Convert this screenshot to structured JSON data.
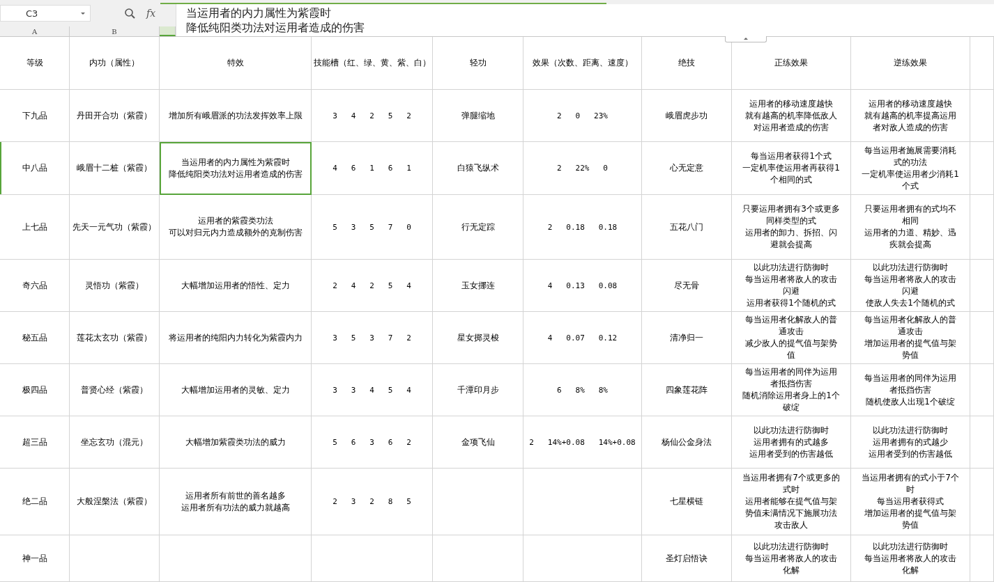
{
  "name_box": "C3",
  "fx_label": "fx",
  "formula": [
    "当运用者的内力属性为紫霞时",
    "降低纯阳类功法对运用者造成的伤害"
  ],
  "columns": [
    {
      "letter": "A",
      "selected": false
    },
    {
      "letter": "B",
      "selected": false
    },
    {
      "selected": true
    }
  ],
  "header": [
    "等级",
    "内功（属性）",
    "特效",
    "技能槽（红、绿、黄、紫、白）",
    "轻功",
    "效果（次数、距离、速度）",
    "绝技",
    "正练效果",
    "逆练效果"
  ],
  "rows": [
    {
      "selected": false,
      "cells": [
        "下九品",
        "丹田开合功（紫霞）",
        "增加所有峨眉派的功法发挥效率上限",
        "3   4   2   5   2",
        "弹腿缩地",
        "2   0   23%",
        "峨眉虎步功",
        [
          "运用者的移动速度越快",
          "就有越高的机率降低敌人对运用者造成的伤害"
        ],
        [
          "运用者的移动速度越快",
          "就有越高的机率提高运用者对敌人造成的伤害"
        ]
      ]
    },
    {
      "selected": true,
      "cells": [
        "中八品",
        "峨眉十二桩（紫霞）",
        [
          "当运用者的内力属性为紫霞时",
          "降低纯阳类功法对运用者造成的伤害"
        ],
        "4   6   1   6   1",
        "白猿飞纵术",
        "2   22%   0",
        "心无定意",
        [
          "每当运用者获得1个式",
          "一定机率使运用者再获得1个相同的式"
        ],
        [
          "每当运用者施展需要消耗式的功法",
          "一定机率使运用者少消耗1个式"
        ]
      ]
    },
    {
      "selected": false,
      "cells": [
        "上七品",
        "先天一元气功（紫霞）",
        [
          "运用者的紫霞类功法",
          "可以对归元内力造成额外的克制伤害"
        ],
        "5   3   5   7   0",
        "行无定踪",
        "2   0.18   0.18",
        "五花八门",
        [
          "只要运用者拥有3个或更多同样类型的式",
          "运用者的卸力、拆招、闪避就会提高"
        ],
        [
          "只要运用者拥有的式均不相同",
          "运用者的力道、精妙、迅疾就会提高"
        ]
      ]
    },
    {
      "selected": false,
      "cells": [
        "奇六品",
        "灵悟功（紫霞）",
        "大幅增加运用者的悟性、定力",
        "2   4   2   5   4",
        "玉女挪连",
        "4   0.13   0.08",
        "尽无骨",
        [
          "以此功法进行防御时",
          "每当运用者将敌人的攻击闪避",
          "运用者获得1个随机的式"
        ],
        [
          "以此功法进行防御时",
          "每当运用者将敌人的攻击闪避",
          "使敌人失去1个随机的式"
        ]
      ]
    },
    {
      "selected": false,
      "cells": [
        "秘五品",
        "莲花太玄功（紫霞）",
        "将运用者的纯阳内力转化为紫霞内力",
        "3   5   3   7   2",
        "星女掷灵梭",
        "4   0.07   0.12",
        "清净归一",
        [
          "每当运用者化解敌人的普通攻击",
          "减少敌人的提气值与架势值"
        ],
        [
          "每当运用者化解敌人的普通攻击",
          "增加运用者的提气值与架势值"
        ]
      ]
    },
    {
      "selected": false,
      "cells": [
        "极四品",
        "普贤心经（紫霞）",
        "大幅增加运用者的灵敏、定力",
        "3   3   4   5   4",
        "千潭印月步",
        "6   8%   8%",
        "四象莲花阵",
        [
          "每当运用者的同伴为运用者抵挡伤害",
          "随机消除运用者身上的1个破绽"
        ],
        [
          "每当运用者的同伴为运用者抵挡伤害",
          "随机使敌人出现1个破绽"
        ]
      ]
    },
    {
      "selected": false,
      "cells": [
        "超三品",
        "坐忘玄功（混元）",
        "大幅增加紫霞类功法的威力",
        "5   6   3   6   2",
        "金项飞仙",
        "2   14%+0.08   14%+0.08",
        "杨仙公金身法",
        [
          "以此功法进行防御时",
          "运用者拥有的式越多",
          "运用者受到的伤害越低"
        ],
        [
          "以此功法进行防御时",
          "运用者拥有的式越少",
          "运用者受到的伤害越低"
        ]
      ]
    },
    {
      "selected": false,
      "cells": [
        "绝二品",
        "大般涅槃法（紫霞）",
        [
          "运用者所有前世的善名越多",
          "运用者所有功法的威力就越高"
        ],
        "2   3   2   8   5",
        null,
        null,
        "七星横链",
        [
          "当运用者拥有7个或更多的式时",
          "运用者能够在提气值与架势值未满情况下施展功法攻击敌人"
        ],
        [
          "当运用者拥有的式小于7个时",
          "每当运用者获得式",
          "增加运用者的提气值与架势值"
        ]
      ]
    },
    {
      "selected": false,
      "cells": [
        "神一品",
        null,
        null,
        null,
        null,
        null,
        "圣灯启悟诀",
        [
          "以此功法进行防御时",
          "每当运用者将敌人的攻击化解"
        ],
        [
          "以此功法进行防御时",
          "每当运用者将敌人的攻击化解"
        ]
      ]
    }
  ]
}
